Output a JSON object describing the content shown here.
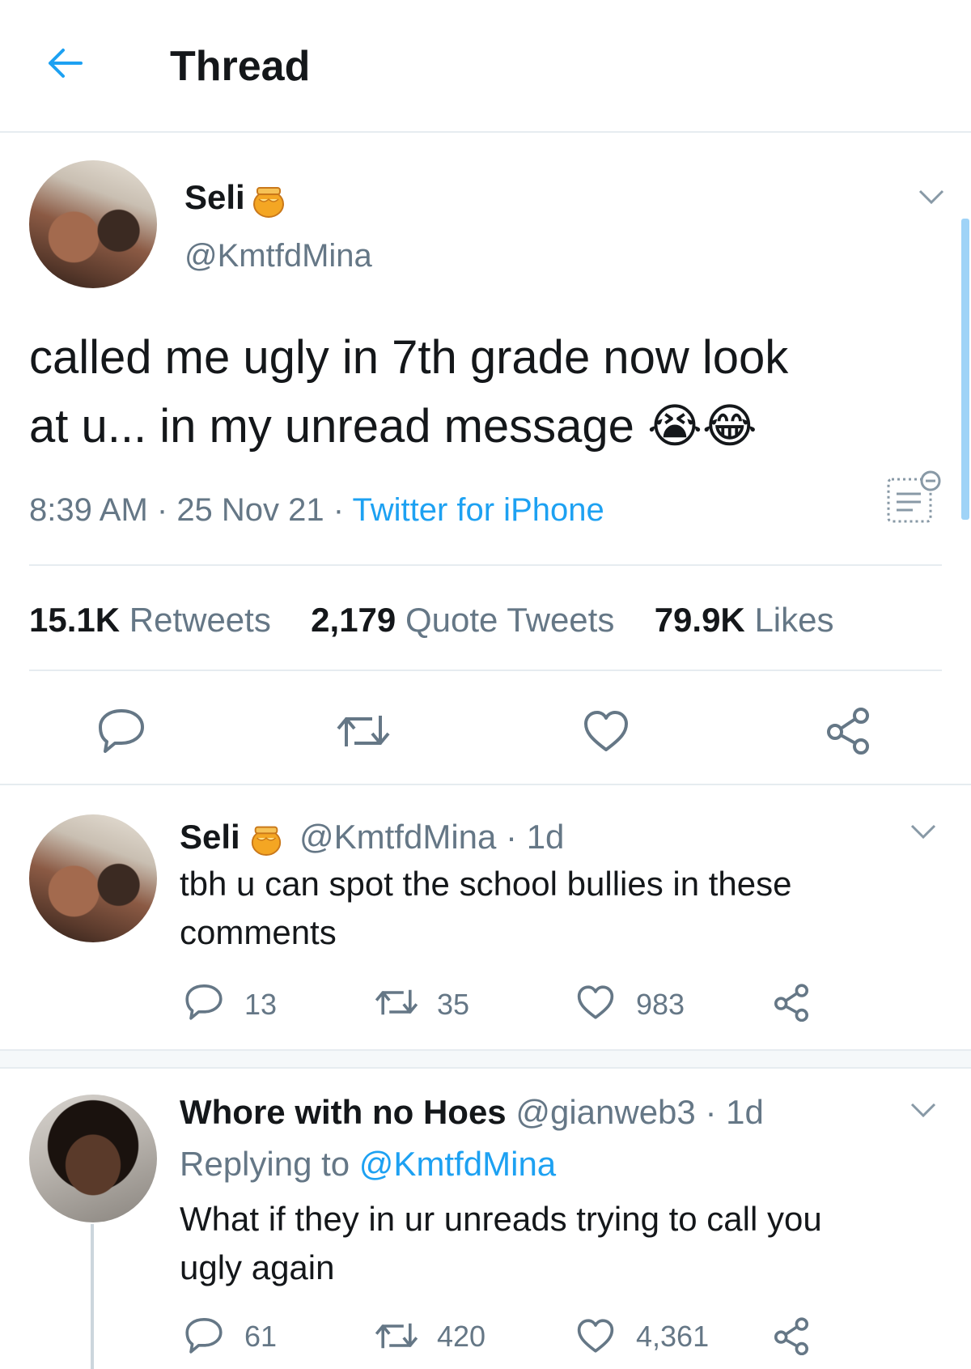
{
  "header": {
    "title": "Thread"
  },
  "main_tweet": {
    "display_name": "Seli",
    "handle": "@KmtfdMina",
    "text_line1": "called me ugly in 7th grade now look",
    "text_line2": "at u... in my unread message",
    "emoji": "😭😂",
    "time": "8:39 AM",
    "sep1": " · ",
    "date": "25 Nov 21",
    "sep2": " · ",
    "source": "Twitter for iPhone",
    "stats": {
      "retweets_count": "15.1K",
      "retweets_label": "Retweets",
      "quotes_count": "2,179",
      "quotes_label": "Quote Tweets",
      "likes_count": "79.9K",
      "likes_label": "Likes"
    }
  },
  "replies": [
    {
      "display_name": "Seli",
      "handle": "@KmtfdMina",
      "time": " · 1d",
      "text_line1": "tbh u can spot the school bullies in these",
      "text_line2": "comments",
      "replies_count": "13",
      "retweets_count": "35",
      "likes_count": "983"
    },
    {
      "display_name": "Whore with no Hoes",
      "handle": "@gianweb3",
      "time": " · 1d",
      "replying_prefix": "Replying to ",
      "replying_to": "@KmtfdMina",
      "text_line1": "What if they in ur unreads trying to call you",
      "text_line2": "ugly again",
      "replies_count": "61",
      "retweets_count": "420",
      "likes_count": "4,361"
    }
  ],
  "colors": {
    "accent": "#1da1f2",
    "muted": "#657786",
    "divider": "#e6ecf0"
  }
}
